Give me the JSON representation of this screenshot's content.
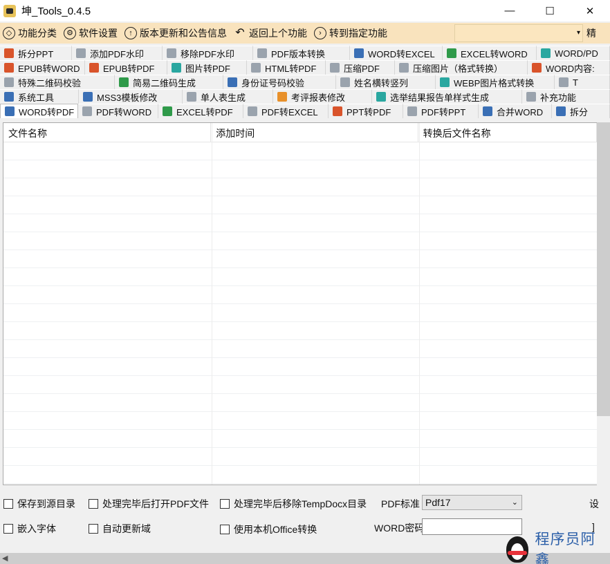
{
  "window": {
    "title": "坤_Tools_0.4.5",
    "minimize": "—",
    "maximize": "☐",
    "close": "✕"
  },
  "toolbar": {
    "items": [
      {
        "label": "功能分类",
        "icon": "cube-icon"
      },
      {
        "label": "软件设置",
        "icon": "gear-icon"
      },
      {
        "label": "版本更新和公告信息",
        "icon": "up-arrow-circle-icon"
      },
      {
        "label": "返回上个功能",
        "icon": "back-arrow-icon"
      },
      {
        "label": "转到指定功能",
        "icon": "right-arrow-circle-icon"
      }
    ],
    "combo_value": "",
    "trailing_label": "精"
  },
  "tabs": {
    "row1": [
      {
        "label": "拆分PPT",
        "color": "red"
      },
      {
        "label": "添加PDF水印",
        "color": "gry"
      },
      {
        "label": "移除PDF水印",
        "color": "gry"
      },
      {
        "label": "PDF版本转换",
        "color": "gry"
      },
      {
        "label": "WORD转EXCEL",
        "color": "blu"
      },
      {
        "label": "EXCEL转WORD",
        "color": "grn"
      },
      {
        "label": "WORD/PD",
        "color": "tea"
      }
    ],
    "row2": [
      {
        "label": "EPUB转WORD",
        "color": "red"
      },
      {
        "label": "EPUB转PDF",
        "color": "red"
      },
      {
        "label": "图片转PDF",
        "color": "tea"
      },
      {
        "label": "HTML转PDF",
        "color": "gry"
      },
      {
        "label": "压缩PDF",
        "color": "gry"
      },
      {
        "label": "压缩图片（格式转换）",
        "color": "gry"
      },
      {
        "label": "WORD内容:",
        "color": "red"
      }
    ],
    "row3": [
      {
        "label": "特殊二维码校验",
        "color": "gry"
      },
      {
        "label": "简易二维码生成",
        "color": "grn"
      },
      {
        "label": "身份证号码校验",
        "color": "blu"
      },
      {
        "label": "姓名横转竖列",
        "color": "gry"
      },
      {
        "label": "WEBP图片格式转换",
        "color": "tea"
      },
      {
        "label": "T",
        "color": "gry"
      }
    ],
    "row4": [
      {
        "label": "系统工具",
        "color": "blu"
      },
      {
        "label": "MSS3模板修改",
        "color": "blu"
      },
      {
        "label": "单人表生成",
        "color": "gry"
      },
      {
        "label": "考评报表修改",
        "color": "org"
      },
      {
        "label": "选举结果报告单样式生成",
        "color": "tea"
      },
      {
        "label": "补充功能",
        "color": "gry"
      }
    ],
    "row5": [
      {
        "label": "WORD转PDF",
        "color": "blu",
        "active": true
      },
      {
        "label": "PDF转WORD",
        "color": "gry"
      },
      {
        "label": "EXCEL转PDF",
        "color": "grn"
      },
      {
        "label": "PDF转EXCEL",
        "color": "gry"
      },
      {
        "label": "PPT转PDF",
        "color": "red"
      },
      {
        "label": "PDF转PPT",
        "color": "gry"
      },
      {
        "label": "合并WORD",
        "color": "blu"
      },
      {
        "label": "拆分",
        "color": "blu"
      }
    ]
  },
  "grid": {
    "columns": [
      "文件名称",
      "添加时间",
      "转换后文件名称"
    ],
    "rows": []
  },
  "options": {
    "save_to_source": "保存到源目录",
    "open_pdf_after": "处理完毕后打开PDF文件",
    "remove_tempdocx": "处理完毕后移除TempDocx目录",
    "pdf_standard_label": "PDF标准",
    "pdf_standard_value": "Pdf17",
    "embed_fonts": "嵌入字体",
    "auto_update_fields": "自动更新域",
    "use_local_office": "使用本机Office转换",
    "word_password_label": "WORD密码",
    "word_password_value": "",
    "cut_right_1": "设",
    "cut_right_2": "]"
  },
  "watermark": {
    "text": "程序员阿鑫"
  }
}
